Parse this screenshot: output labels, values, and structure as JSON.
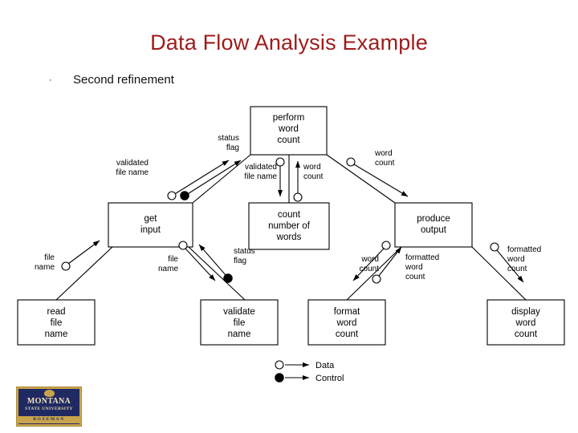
{
  "slide": {
    "title": "Data Flow Analysis Example",
    "title_color": "#9E1B1B",
    "bullet_mark": "·",
    "bullet_text": "Second refinement"
  },
  "diagram": {
    "type": "structure-chart",
    "modules": [
      {
        "id": "perform-word-count",
        "lines": [
          "perform",
          "word",
          "count"
        ]
      },
      {
        "id": "get-input",
        "lines": [
          "get",
          "input"
        ]
      },
      {
        "id": "count-number-of-words",
        "lines": [
          "count",
          "number of",
          "words"
        ]
      },
      {
        "id": "produce-output",
        "lines": [
          "produce",
          "output"
        ]
      },
      {
        "id": "read-file-name",
        "lines": [
          "read",
          "file",
          "name"
        ]
      },
      {
        "id": "validate-file-name",
        "lines": [
          "validate",
          "file",
          "name"
        ]
      },
      {
        "id": "format-word-count",
        "lines": [
          "format",
          "word",
          "count"
        ]
      },
      {
        "id": "display-word-count",
        "lines": [
          "display",
          "word",
          "count"
        ]
      }
    ],
    "flow_labels": [
      {
        "id": "status-flag-top",
        "lines": [
          "status",
          "flag"
        ]
      },
      {
        "id": "validated-file-name-left",
        "lines": [
          "validated",
          "file name"
        ]
      },
      {
        "id": "validated-file-name-center",
        "lines": [
          "validated",
          "file name"
        ]
      },
      {
        "id": "word-count-center",
        "lines": [
          "word",
          "count"
        ]
      },
      {
        "id": "word-count-right",
        "lines": [
          "word",
          "count"
        ]
      },
      {
        "id": "file-name-left",
        "lines": [
          "file",
          "name"
        ]
      },
      {
        "id": "file-name-center",
        "lines": [
          "file",
          "name"
        ]
      },
      {
        "id": "status-flag-bottom",
        "lines": [
          "status",
          "flag"
        ]
      },
      {
        "id": "word-count-lower",
        "lines": [
          "word",
          "count"
        ]
      },
      {
        "id": "formatted-word-count-center",
        "lines": [
          "formatted",
          "word",
          "count"
        ]
      },
      {
        "id": "formatted-word-count-right",
        "lines": [
          "formatted",
          "word",
          "count"
        ]
      }
    ],
    "legend": [
      {
        "id": "legend-data",
        "marker": "open-circle",
        "label": "Data"
      },
      {
        "id": "legend-control",
        "marker": "filled-circle",
        "label": "Control"
      }
    ]
  },
  "logo": {
    "name_top": "MONTANA",
    "name_mid": "STATE UNIVERSITY",
    "name_bottom": "BOZEMAN",
    "bg_color": "#1F2A63",
    "accent_color": "#C9A44C"
  }
}
